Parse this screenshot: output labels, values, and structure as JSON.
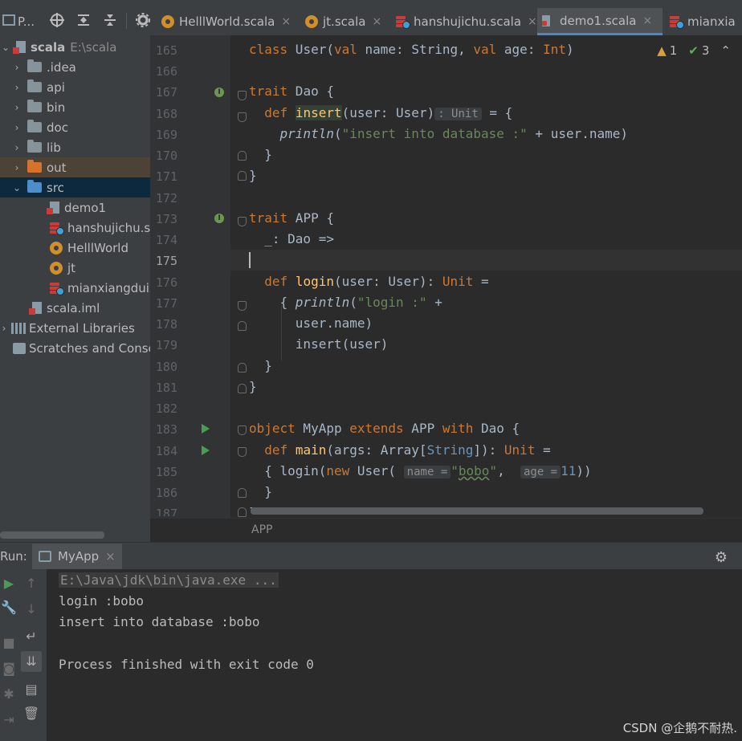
{
  "toolbar": {
    "project_label": "P...",
    "tabs": [
      {
        "label": "HelllWorld.scala",
        "icon": "scala-object-icon"
      },
      {
        "label": "jt.scala",
        "icon": "scala-object-icon"
      },
      {
        "label": "hanshujichu.scala",
        "icon": "scala-worksheet-icon"
      },
      {
        "label": "demo1.scala",
        "icon": "scala-file-icon",
        "active": true
      },
      {
        "label": "mianxia",
        "icon": "scala-worksheet-icon"
      }
    ],
    "close_glyph": "×"
  },
  "tree": {
    "root": {
      "label": "scala",
      "path": "E:\\scala"
    },
    "items": [
      {
        "label": ".idea"
      },
      {
        "label": "api"
      },
      {
        "label": "bin"
      },
      {
        "label": "doc"
      },
      {
        "label": "lib"
      },
      {
        "label": "out"
      },
      {
        "label": "src"
      },
      {
        "label": "demo1"
      },
      {
        "label": "hanshujichu.sc"
      },
      {
        "label": "HelllWorld"
      },
      {
        "label": "jt"
      },
      {
        "label": "mianxiangduix"
      },
      {
        "label": "scala.iml"
      },
      {
        "label": "External Libraries"
      },
      {
        "label": "Scratches and Consc"
      }
    ]
  },
  "editor": {
    "line_numbers": [
      "165",
      "166",
      "167",
      "168",
      "169",
      "170",
      "171",
      "172",
      "173",
      "174",
      "175",
      "176",
      "177",
      "178",
      "179",
      "180",
      "181",
      "182",
      "183",
      "184",
      "185",
      "186",
      "187"
    ],
    "warnings_count": "1",
    "ok_count": "3",
    "breadcrumb": "APP",
    "inlay_unit": ": Unit",
    "inlay_name": "name =",
    "inlay_age": "age ="
  },
  "run": {
    "label": "Run:",
    "tab_label": "MyApp",
    "console": [
      "E:\\Java\\jdk\\bin\\java.exe ...",
      "login :bobo",
      "insert into database :bobo",
      "",
      "Process finished with exit code 0"
    ]
  },
  "watermark": "CSDN @企鹅不耐热."
}
